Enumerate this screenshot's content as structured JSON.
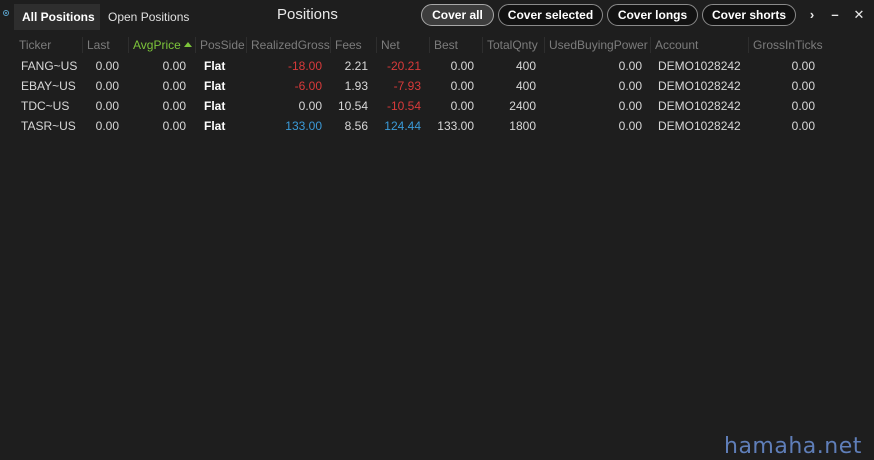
{
  "window": {
    "title": "Positions",
    "tabs": [
      {
        "label": "All Positions",
        "active": true
      },
      {
        "label": "Open Positions",
        "active": false
      }
    ],
    "buttons": {
      "cover_all": "Cover all",
      "cover_selected": "Cover selected",
      "cover_longs": "Cover longs",
      "cover_shorts": "Cover shorts"
    },
    "controls": {
      "more": "›",
      "minimize": "–",
      "close": "✕"
    }
  },
  "table": {
    "columns": {
      "ticker": "Ticker",
      "last": "Last",
      "avgprice": "AvgPrice",
      "posside": "PosSide",
      "realizedgross": "RealizedGross",
      "fees": "Fees",
      "net": "Net",
      "best": "Best",
      "totalqnty": "TotalQnty",
      "usedbuyingpower": "UsedBuyingPower",
      "account": "Account",
      "grossinticks": "GrossInTicks"
    },
    "sorted_column": "AvgPrice",
    "rows": [
      {
        "ticker": "FANG~US",
        "last": "0.00",
        "avgprice": "0.00",
        "posside": "Flat",
        "realizedgross": "-18.00",
        "fees": "2.21",
        "net": "-20.21",
        "best": "0.00",
        "totalqnty": "400",
        "usedbuyingpower": "0.00",
        "account": "DEMO1028242",
        "grossinticks": "0.00"
      },
      {
        "ticker": "EBAY~US",
        "last": "0.00",
        "avgprice": "0.00",
        "posside": "Flat",
        "realizedgross": "-6.00",
        "fees": "1.93",
        "net": "-7.93",
        "best": "0.00",
        "totalqnty": "400",
        "usedbuyingpower": "0.00",
        "account": "DEMO1028242",
        "grossinticks": "0.00"
      },
      {
        "ticker": "TDC~US",
        "last": "0.00",
        "avgprice": "0.00",
        "posside": "Flat",
        "realizedgross": "0.00",
        "fees": "10.54",
        "net": "-10.54",
        "best": "0.00",
        "totalqnty": "2400",
        "usedbuyingpower": "0.00",
        "account": "DEMO1028242",
        "grossinticks": "0.00"
      },
      {
        "ticker": "TASR~US",
        "last": "0.00",
        "avgprice": "0.00",
        "posside": "Flat",
        "realizedgross": "133.00",
        "fees": "8.56",
        "net": "124.44",
        "best": "133.00",
        "totalqnty": "1800",
        "usedbuyingpower": "0.00",
        "account": "DEMO1028242",
        "grossinticks": "0.00"
      }
    ]
  },
  "colors": {
    "negative": "#d83a3a",
    "positive": "#3a9ad8",
    "sorted_header": "#7cc43a"
  },
  "watermark": "hamaha.net"
}
